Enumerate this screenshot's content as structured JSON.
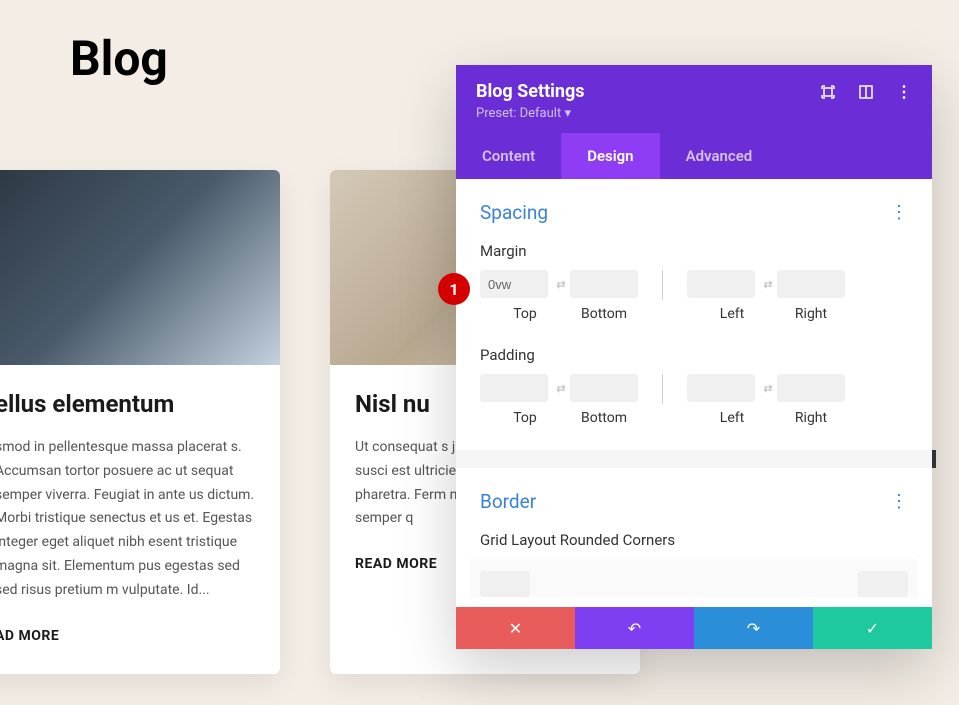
{
  "page": {
    "title": "Blog"
  },
  "cards": [
    {
      "title": "ellus elementum",
      "excerpt": "smod in pellentesque massa placerat s. Accumsan tortor posuere ac ut sequat semper viverra. Feugiat in ante us dictum. Morbi tristique senectus et us et. Egestas integer eget aliquet nibh esent tristique magna sit. Elementum pus egestas sed sed risus pretium m vulputate. Id...",
      "link": "AD MORE"
    },
    {
      "title": "Nisl nu",
      "excerpt": "Ut consequat s justo laoreet sit amet nisl susci est ultricies. Fe diam. Donec e pharetra. Ferm non pulvinar ne vitae semper q",
      "link": "READ MORE"
    }
  ],
  "panel": {
    "title": "Blog Settings",
    "preset": "Preset: Default",
    "tabs": {
      "content": "Content",
      "design": "Design",
      "advanced": "Advanced"
    },
    "spacing": {
      "title": "Spacing",
      "margin_label": "Margin",
      "padding_label": "Padding",
      "margin": {
        "top": "0vw",
        "bottom": "",
        "left": "",
        "right": ""
      },
      "padding": {
        "top": "",
        "bottom": "",
        "left": "",
        "right": ""
      },
      "captions": {
        "top": "Top",
        "bottom": "Bottom",
        "left": "Left",
        "right": "Right"
      }
    },
    "border": {
      "title": "Border",
      "corners_label": "Grid Layout Rounded Corners"
    }
  },
  "marker": "1"
}
